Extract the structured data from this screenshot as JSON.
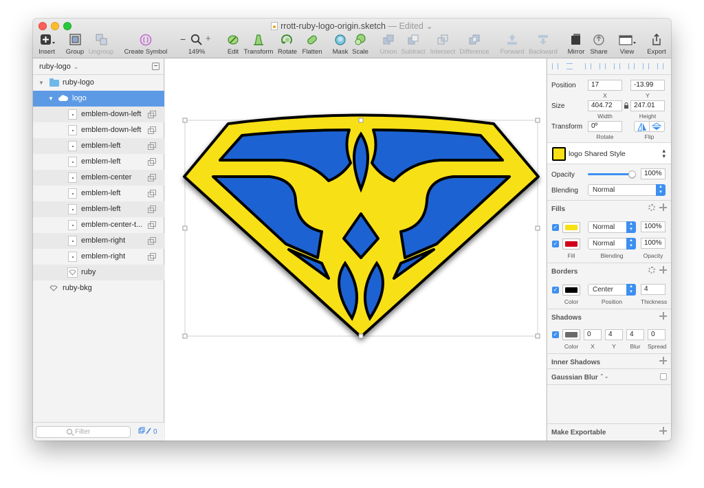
{
  "window": {
    "title": "rrott-ruby-logo-origin.sketch",
    "status": "— Edited",
    "status_chevron": "⌄"
  },
  "toolbar": {
    "insert": "Insert",
    "group": "Group",
    "ungroup": "Ungroup",
    "create_symbol": "Create Symbol",
    "zoom_minus": "−",
    "zoom_plus": "+",
    "zoom_level": "149%",
    "edit": "Edit",
    "transform": "Transform",
    "rotate": "Rotate",
    "flatten": "Flatten",
    "mask": "Mask",
    "scale": "Scale",
    "union": "Union",
    "subtract": "Subtract",
    "intersect": "Intersect",
    "difference": "Difference",
    "forward": "Forward",
    "backward": "Backward",
    "mirror": "Mirror",
    "share": "Share",
    "view": "View",
    "export": "Export"
  },
  "sidebar": {
    "page": "ruby-logo",
    "page_chevron": "⌄",
    "layers": [
      {
        "label": "ruby-logo"
      },
      {
        "label": "logo"
      },
      {
        "label": "emblem-down-left"
      },
      {
        "label": "emblem-down-left"
      },
      {
        "label": "emblem-left"
      },
      {
        "label": "emblem-left"
      },
      {
        "label": "emblem-center"
      },
      {
        "label": "emblem-left"
      },
      {
        "label": "emblem-left"
      },
      {
        "label": "emblem-center-t..."
      },
      {
        "label": "emblem-right"
      },
      {
        "label": "emblem-right"
      },
      {
        "label": "ruby"
      },
      {
        "label": "ruby-bkg"
      }
    ],
    "filter_placeholder": "Filter",
    "edited_count": "0"
  },
  "inspector": {
    "position_label": "Position",
    "x_value": "17",
    "y_value": "-13.99",
    "x_sub": "X",
    "y_sub": "Y",
    "size_label": "Size",
    "width_value": "404.72",
    "height_value": "247.01",
    "width_sub": "Width",
    "height_sub": "Height",
    "transform_label": "Transform",
    "rotate_value": "0º",
    "rotate_sub": "Rotate",
    "flip_sub": "Flip",
    "shared_style": "logo Shared Style",
    "opacity_label": "Opacity",
    "opacity_value": "100%",
    "opacity_level": 1.0,
    "blending_label": "Blending",
    "blending_value": "Normal",
    "fills_title": "Fills",
    "fills": [
      {
        "color": "#f7e016",
        "blending": "Normal",
        "opacity": "100%"
      },
      {
        "color": "#d0021b",
        "blending": "Normal",
        "opacity": "100%"
      }
    ],
    "fill_sub": "Fill",
    "fill_blending_sub": "Blending",
    "fill_opacity_sub": "Opacity",
    "borders_title": "Borders",
    "border_color": "#000000",
    "border_position": "Center",
    "border_thickness": "4",
    "border_color_sub": "Color",
    "border_position_sub": "Position",
    "border_thickness_sub": "Thickness",
    "shadows_title": "Shadows",
    "shadow_color": "#6b6b6b",
    "shadow_x": "0",
    "shadow_y": "4",
    "shadow_blur": "4",
    "shadow_spread": "0",
    "shadow_color_sub": "Color",
    "shadow_x_sub": "X",
    "shadow_y_sub": "Y",
    "shadow_blur_sub": "Blur",
    "shadow_spread_sub": "Spread",
    "inner_shadows_title": "Inner Shadows",
    "gaussian_blur_title": "Gaussian Blur",
    "gaussian_chevron": "⌃⌄",
    "make_exportable": "Make Exportable"
  },
  "colors": {
    "logo_yellow": "#f7e016",
    "logo_blue": "#1a62d2",
    "logo_outline": "#000000",
    "selection": "#5d9ae5",
    "accent": "#3d8ff0"
  }
}
